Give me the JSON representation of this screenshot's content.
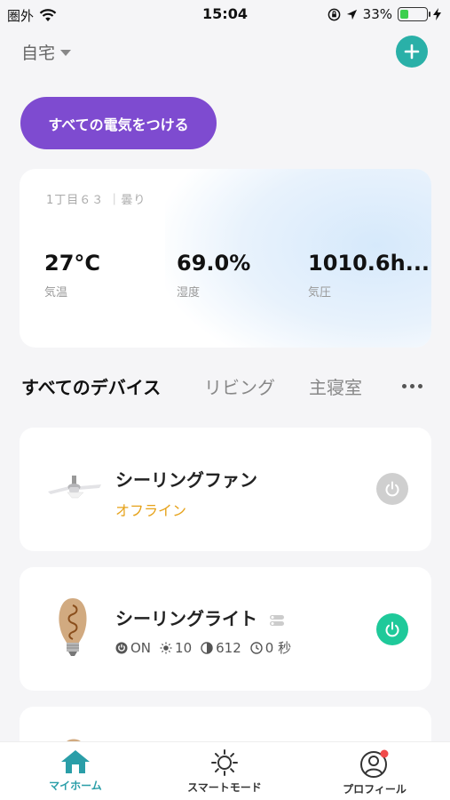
{
  "status_bar": {
    "carrier": "圏外",
    "time": "15:04",
    "battery": "33%",
    "battery_level": 0.33
  },
  "header": {
    "home_name": "自宅",
    "add_icon": "plus-icon"
  },
  "all_lights_button": "すべての電気をつける",
  "weather": {
    "location": "1丁目６３ ｜曇り",
    "metrics": [
      {
        "value": "27°C",
        "label": "気温"
      },
      {
        "value": "69.0%",
        "label": "湿度"
      },
      {
        "value": "1010.6h...",
        "label": "気圧"
      }
    ]
  },
  "tabs": [
    {
      "label": "すべてのデバイス",
      "active": true
    },
    {
      "label": "リビング",
      "active": false
    },
    {
      "label": "主寝室",
      "active": false
    }
  ],
  "devices": [
    {
      "name": "シーリングファン",
      "status": "オフライン",
      "power": "off",
      "power_color": "#cfcfcf"
    },
    {
      "name": "シーリングライト",
      "power": "on",
      "power_color": "#1fc99a",
      "stats": {
        "mode": "ON",
        "brightness": "10",
        "color_temp": "612",
        "timer": "0 秒"
      }
    }
  ],
  "bottom_nav": [
    {
      "label": "マイホーム",
      "icon": "home-icon",
      "active": true
    },
    {
      "label": "スマートモード",
      "icon": "sun-icon",
      "active": false
    },
    {
      "label": "プロフィール",
      "icon": "profile-icon",
      "active": false
    }
  ],
  "colors": {
    "accent": "#2ab0a8",
    "purple_button": "#7e4bd0",
    "offline": "#e6a21a"
  }
}
